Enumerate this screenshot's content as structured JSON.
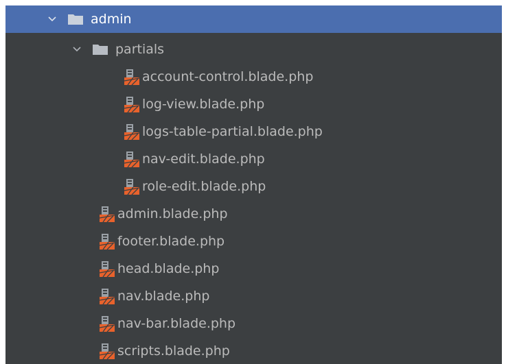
{
  "tree": {
    "items": [
      {
        "label": "admin",
        "type": "folder",
        "expanded": true,
        "selected": true,
        "depth": 0
      },
      {
        "label": "partials",
        "type": "folder",
        "expanded": true,
        "selected": false,
        "depth": 1
      },
      {
        "label": "account-control.blade.php",
        "type": "file",
        "depth": 2
      },
      {
        "label": "log-view.blade.php",
        "type": "file",
        "depth": 2
      },
      {
        "label": "logs-table-partial.blade.php",
        "type": "file",
        "depth": 2
      },
      {
        "label": "nav-edit.blade.php",
        "type": "file",
        "depth": 2
      },
      {
        "label": "role-edit.blade.php",
        "type": "file",
        "depth": 2
      },
      {
        "label": "admin.blade.php",
        "type": "file",
        "depth": 1
      },
      {
        "label": "footer.blade.php",
        "type": "file",
        "depth": 1
      },
      {
        "label": "head.blade.php",
        "type": "file",
        "depth": 1
      },
      {
        "label": "nav.blade.php",
        "type": "file",
        "depth": 1
      },
      {
        "label": "nav-bar.blade.php",
        "type": "file",
        "depth": 1
      },
      {
        "label": "scripts.blade.php",
        "type": "file",
        "depth": 1
      }
    ]
  },
  "icons": {
    "expanded": "chevron-down-icon",
    "folder": "folder-icon",
    "file": "blade-file-icon"
  },
  "colors": {
    "panel_background": "#3c3f41",
    "selection": "#4b6eaf",
    "text": "#bbbbbb",
    "selected_text": "#ffffff",
    "folder": "#b7bcc3",
    "blade_orange": "#e8622c"
  }
}
